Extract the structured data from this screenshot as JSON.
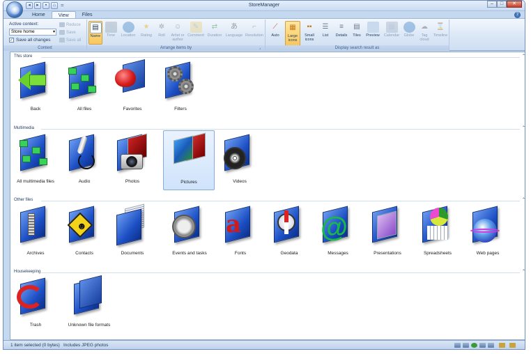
{
  "window": {
    "title": "StoreManager",
    "minimize": "–",
    "maximize": "□",
    "close": "✕"
  },
  "quick_access": {
    "items": [
      "back-icon",
      "forward-icon",
      "save-icon",
      "home-icon"
    ],
    "overflow": "="
  },
  "tabs": [
    {
      "label": "Home"
    },
    {
      "label": "View",
      "active": true
    },
    {
      "label": "Files"
    }
  ],
  "help_icon": "?",
  "ribbon": {
    "context": {
      "active_context_label": "Active context:",
      "store_select_value": "Store home",
      "save_all_changes_label": "Save all changes",
      "save_all_changes_checked": true,
      "reduce_label": "Reduce",
      "save_label": "Save",
      "save_all_label": "Save all",
      "group_label": "Context"
    },
    "arrange": {
      "group_label": "Arrange items by",
      "buttons": [
        {
          "label": "Name",
          "icon": "name-icon",
          "selected": true
        },
        {
          "label": "Time",
          "icon": "clock-icon"
        },
        {
          "label": "Location",
          "icon": "globe-icon"
        },
        {
          "label": "Rating",
          "icon": "star-icon"
        },
        {
          "label": "Roll",
          "icon": "film-roll-icon"
        },
        {
          "label": "Artist or author",
          "icon": "person-icon"
        },
        {
          "label": "Comment",
          "icon": "comment-icon"
        },
        {
          "label": "Duration",
          "icon": "duration-icon"
        },
        {
          "label": "Language",
          "icon": "language-icon"
        },
        {
          "label": "Resolution",
          "icon": "resolution-icon"
        }
      ]
    },
    "display": {
      "group_label": "Display search result as",
      "buttons": [
        {
          "label": "Auto",
          "icon": "auto-icon"
        },
        {
          "label": "Large icons",
          "icon": "large-icons-icon",
          "selected": true
        },
        {
          "label": "Small icons",
          "icon": "small-icons-icon"
        },
        {
          "label": "List",
          "icon": "list-icon"
        },
        {
          "label": "Details",
          "icon": "details-icon"
        },
        {
          "label": "Tiles",
          "icon": "tiles-icon"
        },
        {
          "label": "Preview",
          "icon": "preview-icon"
        },
        {
          "label": "Calendar",
          "icon": "calendar-icon"
        },
        {
          "label": "Globe",
          "icon": "globe-icon"
        },
        {
          "label": "Tag cloud",
          "icon": "tag-cloud-icon"
        },
        {
          "label": "Timeline",
          "icon": "timeline-icon"
        }
      ]
    }
  },
  "sections": [
    {
      "title": "This store",
      "items": [
        {
          "label": "Back",
          "icon": "back-arrow-folder-icon"
        },
        {
          "label": "All files",
          "icon": "all-files-folder-icon"
        },
        {
          "label": "Favorites",
          "icon": "favorites-heart-folder-icon"
        },
        {
          "label": "Filters",
          "icon": "filters-gears-folder-icon"
        }
      ]
    },
    {
      "title": "Multimedia",
      "items": [
        {
          "label": "All multimedia files",
          "icon": "multimedia-folder-icon"
        },
        {
          "label": "Audio",
          "icon": "audio-microphone-folder-icon"
        },
        {
          "label": "Photos",
          "icon": "photos-camera-folder-icon"
        },
        {
          "label": "Pictures",
          "icon": "pictures-folder-icon",
          "selected": true
        },
        {
          "label": "Videos",
          "icon": "videos-film-reel-folder-icon"
        }
      ]
    },
    {
      "title": "Other files",
      "items": [
        {
          "label": "Archives",
          "icon": "archives-zipper-folder-icon"
        },
        {
          "label": "Contacts",
          "icon": "contacts-sign-folder-icon"
        },
        {
          "label": "Documents",
          "icon": "documents-folder-icon"
        },
        {
          "label": "Events and tasks",
          "icon": "events-clock-folder-icon"
        },
        {
          "label": "Fonts",
          "icon": "fonts-letter-folder-icon"
        },
        {
          "label": "Geodata",
          "icon": "geodata-compass-folder-icon"
        },
        {
          "label": "Messages",
          "icon": "messages-at-folder-icon"
        },
        {
          "label": "Presentations",
          "icon": "presentations-folder-icon"
        },
        {
          "label": "Spreadsheets",
          "icon": "spreadsheets-chart-folder-icon"
        },
        {
          "label": "Web pages",
          "icon": "web-pages-globe-folder-icon"
        }
      ]
    },
    {
      "title": "Housekeeping",
      "items": [
        {
          "label": "Trash",
          "icon": "trash-recycle-folder-icon"
        },
        {
          "label": "Unknown file formats",
          "icon": "unknown-formats-folder-icon"
        }
      ]
    }
  ],
  "status": {
    "selection": "1 item selected (0 bytes)",
    "info": "Includes JPEG photos",
    "icons": [
      "store-icon",
      "filter-icon",
      "refresh-icon",
      "share-icon",
      "settings-icon",
      "view-icon",
      "people-icon"
    ]
  }
}
